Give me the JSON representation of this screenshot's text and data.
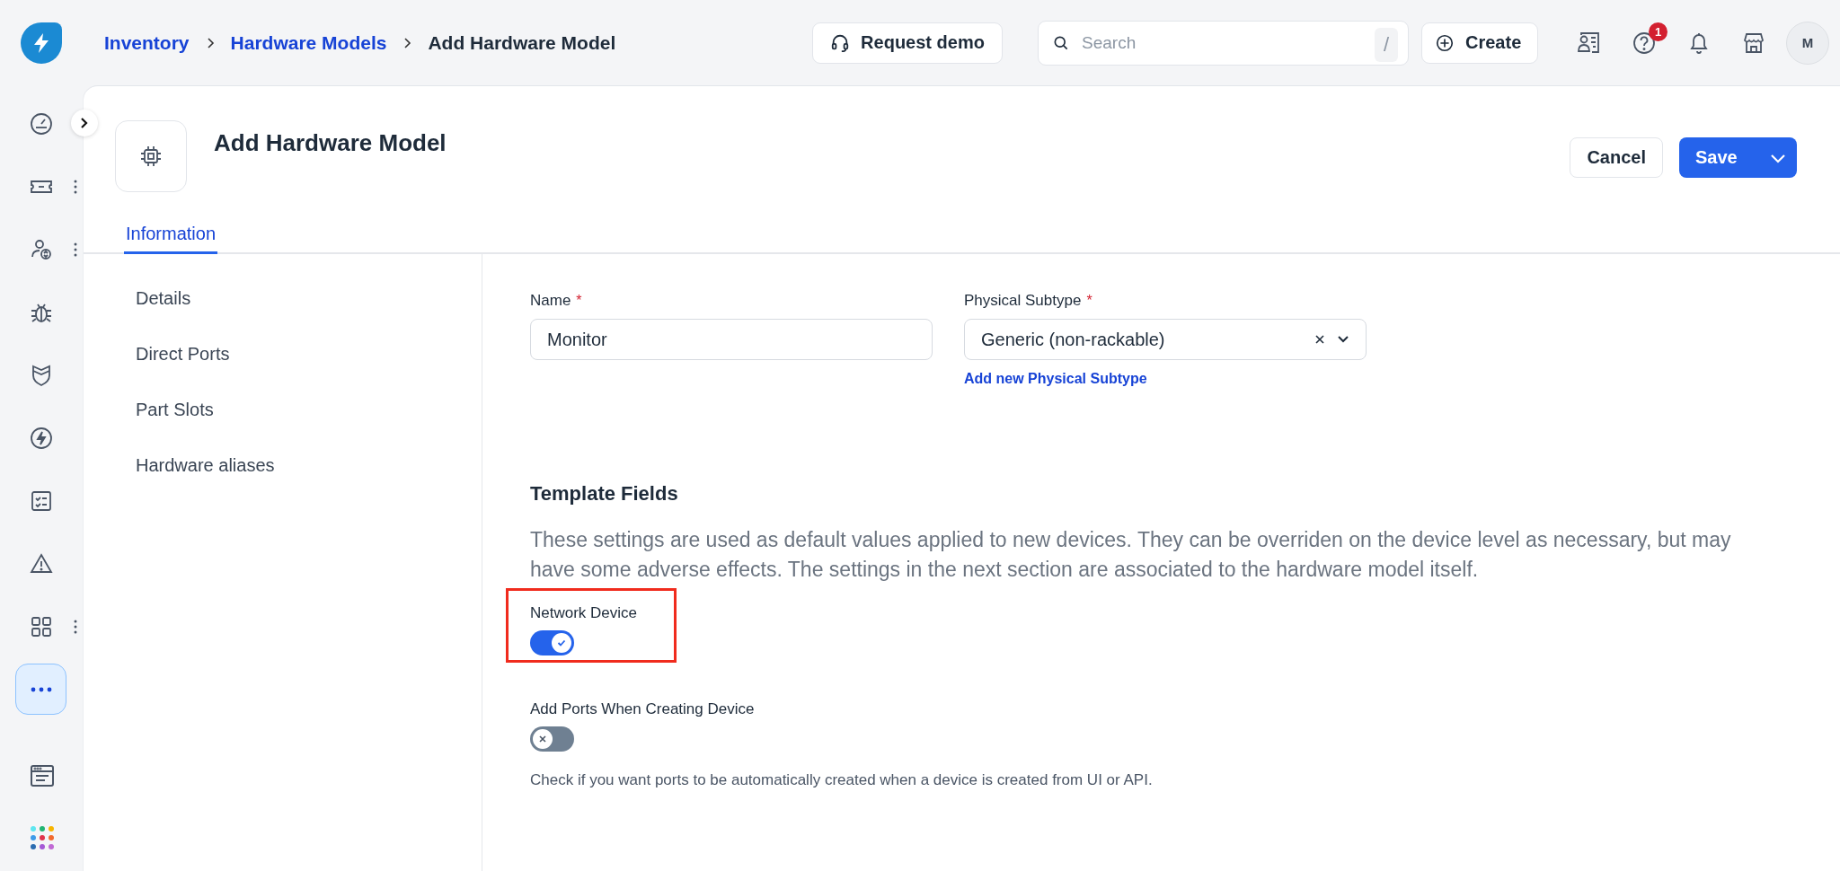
{
  "breadcrumb": [
    {
      "label": "Inventory",
      "link": true
    },
    {
      "label": "Hardware Models",
      "link": true
    },
    {
      "label": "Add Hardware Model",
      "link": false
    }
  ],
  "topbar": {
    "request_demo": "Request demo",
    "search": {
      "placeholder": "Search",
      "shortcut": "/"
    },
    "create": "Create",
    "help_badge": "1",
    "avatar": "M"
  },
  "nav": [
    {
      "selected": false,
      "has_menu": false
    },
    {
      "selected": false,
      "has_menu": true
    },
    {
      "selected": false,
      "has_menu": true
    },
    {
      "selected": false,
      "has_menu": false
    },
    {
      "selected": false,
      "has_menu": false
    },
    {
      "selected": false,
      "has_menu": false
    },
    {
      "selected": false,
      "has_menu": false
    },
    {
      "selected": false,
      "has_menu": false
    },
    {
      "selected": false,
      "has_menu": true
    },
    {
      "selected": true,
      "has_menu": false
    }
  ],
  "page": {
    "title": "Add Hardware Model",
    "cancel": "Cancel",
    "save": "Save",
    "tabs": [
      {
        "label": "Information",
        "selected": true
      }
    ]
  },
  "sections": [
    {
      "label": "Details"
    },
    {
      "label": "Direct Ports"
    },
    {
      "label": "Part Slots"
    },
    {
      "label": "Hardware aliases"
    }
  ],
  "fields": [
    {
      "kind": "text",
      "label": "Name",
      "required_mark": "*",
      "value": "Monitor"
    },
    {
      "kind": "select",
      "label": "Physical Subtype",
      "required_mark": "*",
      "value": "Generic (non-rackable)",
      "link": "Add new Physical Subtype"
    }
  ],
  "template": {
    "heading": "Template Fields",
    "description": "These settings are used as default values applied to new devices. They can be overriden on the device level as necessary, but may have some adverse effects. The settings in the next section are associated to the hardware model itself.",
    "toggles": [
      {
        "label": "Network Device",
        "on": true,
        "highlighted": true
      },
      {
        "label": "Add Ports When Creating Device",
        "on": false,
        "highlighted": false,
        "hint": "Check if you want ports to be automatically created when a device is created from UI or API."
      }
    ]
  }
}
